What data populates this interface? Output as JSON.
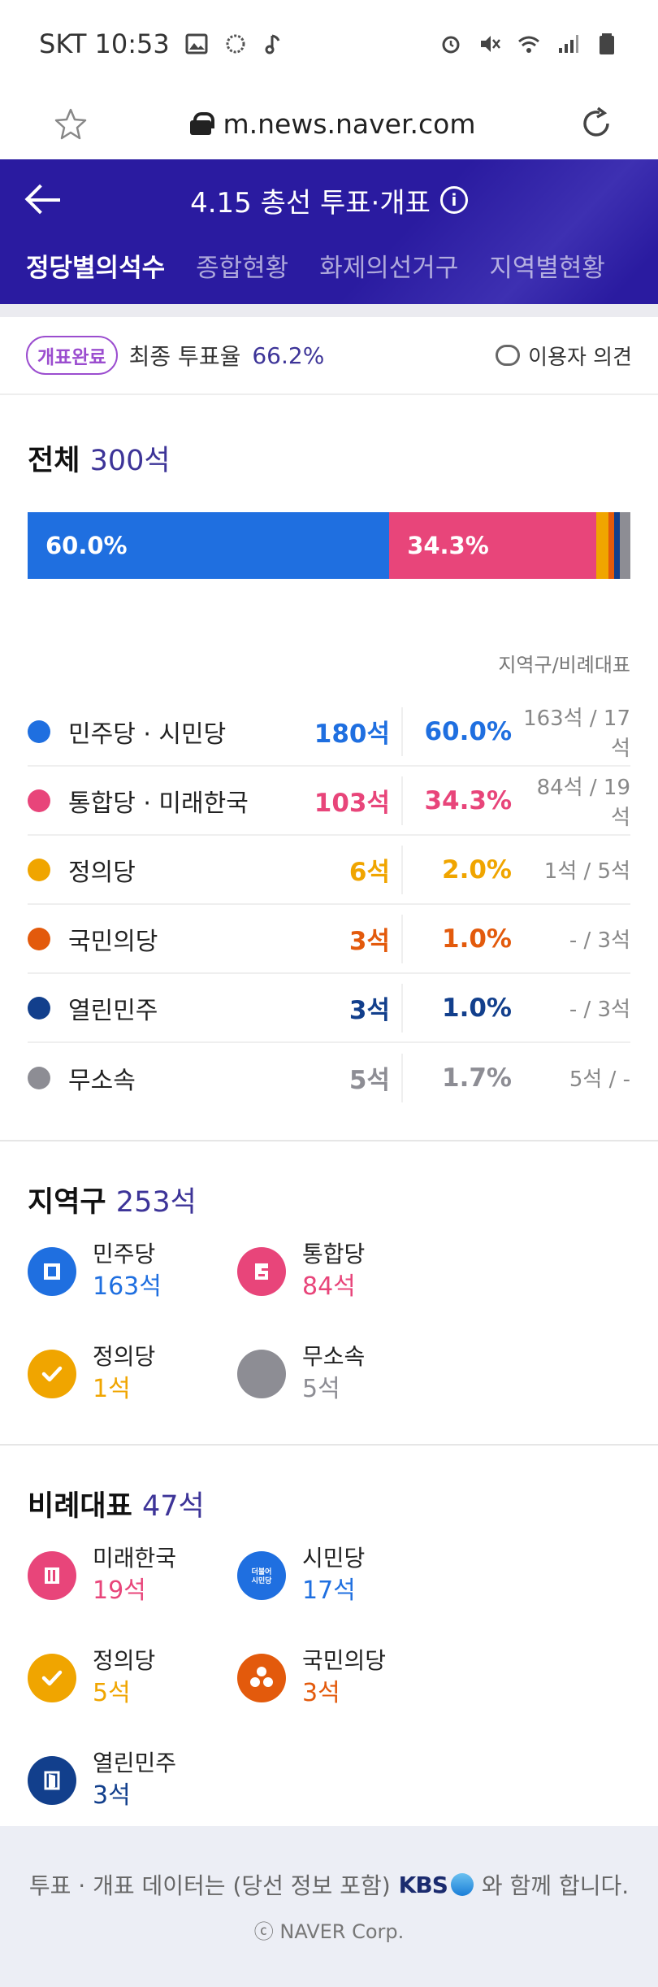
{
  "status_bar": {
    "carrier_time": "SKT 10:53"
  },
  "browser": {
    "url": "m.news.naver.com"
  },
  "header": {
    "title": "4.15 총선 투표·개표",
    "tabs": [
      "정당별의석수",
      "종합현황",
      "화제의선거구",
      "지역별현황"
    ]
  },
  "status": {
    "badge": "개표완료",
    "turnout_label": "최종 투표율",
    "turnout_value": "66.2%",
    "opinion": "이용자 의견"
  },
  "total": {
    "title": "전체",
    "seats": "300석",
    "bar": [
      {
        "label": "60.0%",
        "value": 60.0,
        "color": "#1f6fe0"
      },
      {
        "label": "34.3%",
        "value": 34.3,
        "color": "#e8457a"
      },
      {
        "label": "",
        "value": 2.0,
        "color": "#f0a500"
      },
      {
        "label": "",
        "value": 1.0,
        "color": "#e35a0c"
      },
      {
        "label": "",
        "value": 1.0,
        "color": "#123f8c"
      },
      {
        "label": "",
        "value": 1.7,
        "color": "#8d8d94"
      }
    ],
    "sub_header": "지역구/비례대표",
    "parties": [
      {
        "name": "민주당 · 시민당",
        "seats": "180석",
        "pct": "60.0%",
        "detail": "163석 / 17석",
        "color": "#1f6fe0"
      },
      {
        "name": "통합당 · 미래한국",
        "seats": "103석",
        "pct": "34.3%",
        "detail": "84석 / 19석",
        "color": "#e8457a"
      },
      {
        "name": "정의당",
        "seats": "6석",
        "pct": "2.0%",
        "detail": "1석 / 5석",
        "color": "#f0a500"
      },
      {
        "name": "국민의당",
        "seats": "3석",
        "pct": "1.0%",
        "detail": "- / 3석",
        "color": "#e35a0c"
      },
      {
        "name": "열린민주",
        "seats": "3석",
        "pct": "1.0%",
        "detail": "- / 3석",
        "color": "#123f8c"
      },
      {
        "name": "무소속",
        "seats": "5석",
        "pct": "1.7%",
        "detail": "5석 / -",
        "color": "#8d8d94"
      }
    ]
  },
  "district": {
    "title": "지역구",
    "seats": "253석",
    "items": [
      {
        "name": "민주당",
        "seats": "163석",
        "color": "#1f6fe0",
        "icon": "minjoo-logo-icon"
      },
      {
        "name": "통합당",
        "seats": "84석",
        "color": "#e8457a",
        "icon": "tonghap-logo-icon"
      },
      {
        "name": "정의당",
        "seats": "1석",
        "color": "#f0a500",
        "icon": "check-icon"
      },
      {
        "name": "무소속",
        "seats": "5석",
        "color": "#8d8d94",
        "icon": "independent-icon"
      }
    ]
  },
  "proportional": {
    "title": "비례대표",
    "seats": "47석",
    "items": [
      {
        "name": "미래한국",
        "seats": "19석",
        "color": "#e8457a",
        "icon": "miraehanguk-logo-icon"
      },
      {
        "name": "시민당",
        "seats": "17석",
        "color": "#1f6fe0",
        "icon": "simin-logo-icon",
        "logo_text": "더불어\n시민당"
      },
      {
        "name": "정의당",
        "seats": "5석",
        "color": "#f0a500",
        "icon": "check-icon"
      },
      {
        "name": "국민의당",
        "seats": "3석",
        "color": "#e35a0c",
        "icon": "kookmin-logo-icon"
      },
      {
        "name": "열린민주",
        "seats": "3석",
        "color": "#123f8c",
        "icon": "yeollin-logo-icon"
      }
    ]
  },
  "footer": {
    "text_before": "투표 · 개표 데이터는 (당선 정보 포함)",
    "kbs": "KBS",
    "text_after": "와 함께 합니다.",
    "copyright": "ⓒ NAVER Corp."
  }
}
